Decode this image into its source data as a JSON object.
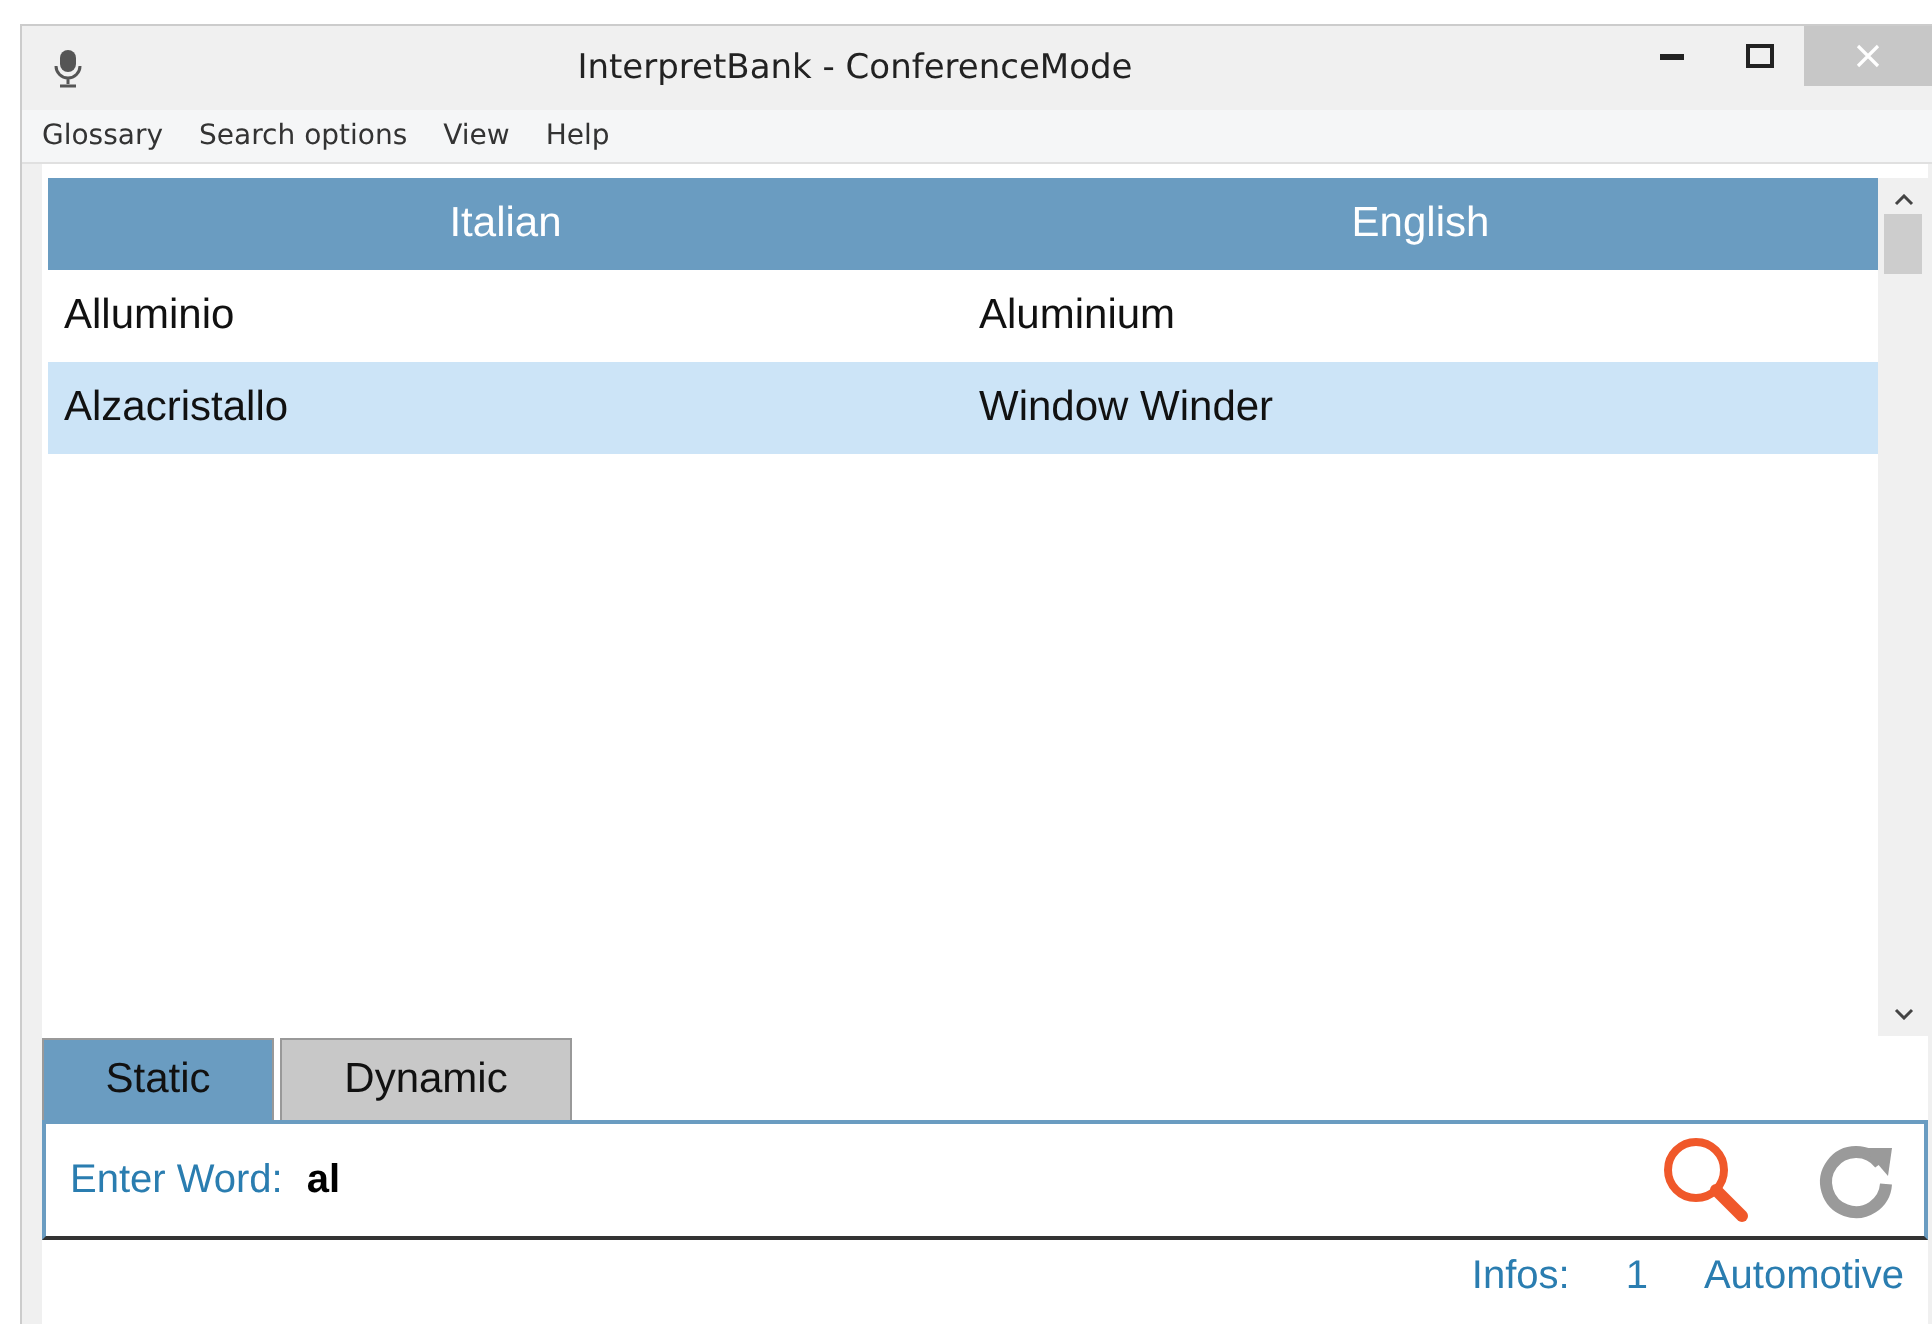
{
  "window": {
    "title": "InterpretBank - ConferenceMode"
  },
  "menu": [
    "Glossary",
    "Search options",
    "View",
    "Help"
  ],
  "table": {
    "columns": [
      "Italian",
      "English"
    ],
    "rows": [
      {
        "cells": [
          "Alluminio",
          "Aluminium"
        ],
        "selected": false
      },
      {
        "cells": [
          "Alzacristallo",
          "Window Winder"
        ],
        "selected": true
      }
    ]
  },
  "tabs": [
    {
      "label": "Static",
      "selected": true
    },
    {
      "label": "Dynamic",
      "selected": false
    }
  ],
  "search": {
    "label": "Enter Word:",
    "value": "al"
  },
  "status_bar": {
    "label": "Infos:",
    "count": "1",
    "glossary": "Automotive"
  }
}
